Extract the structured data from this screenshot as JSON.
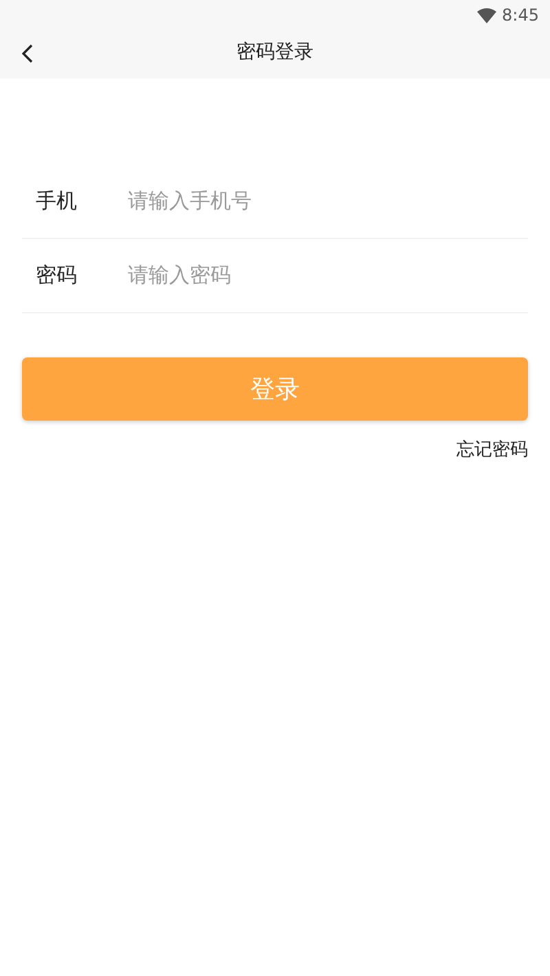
{
  "status_bar": {
    "time": "8:45"
  },
  "header": {
    "title": "密码登录"
  },
  "fields": [
    {
      "label": "手机",
      "placeholder": "请输入手机号"
    },
    {
      "label": "密码",
      "placeholder": "请输入密码"
    }
  ],
  "login_button": "登录",
  "forgot_link": "忘记密码"
}
